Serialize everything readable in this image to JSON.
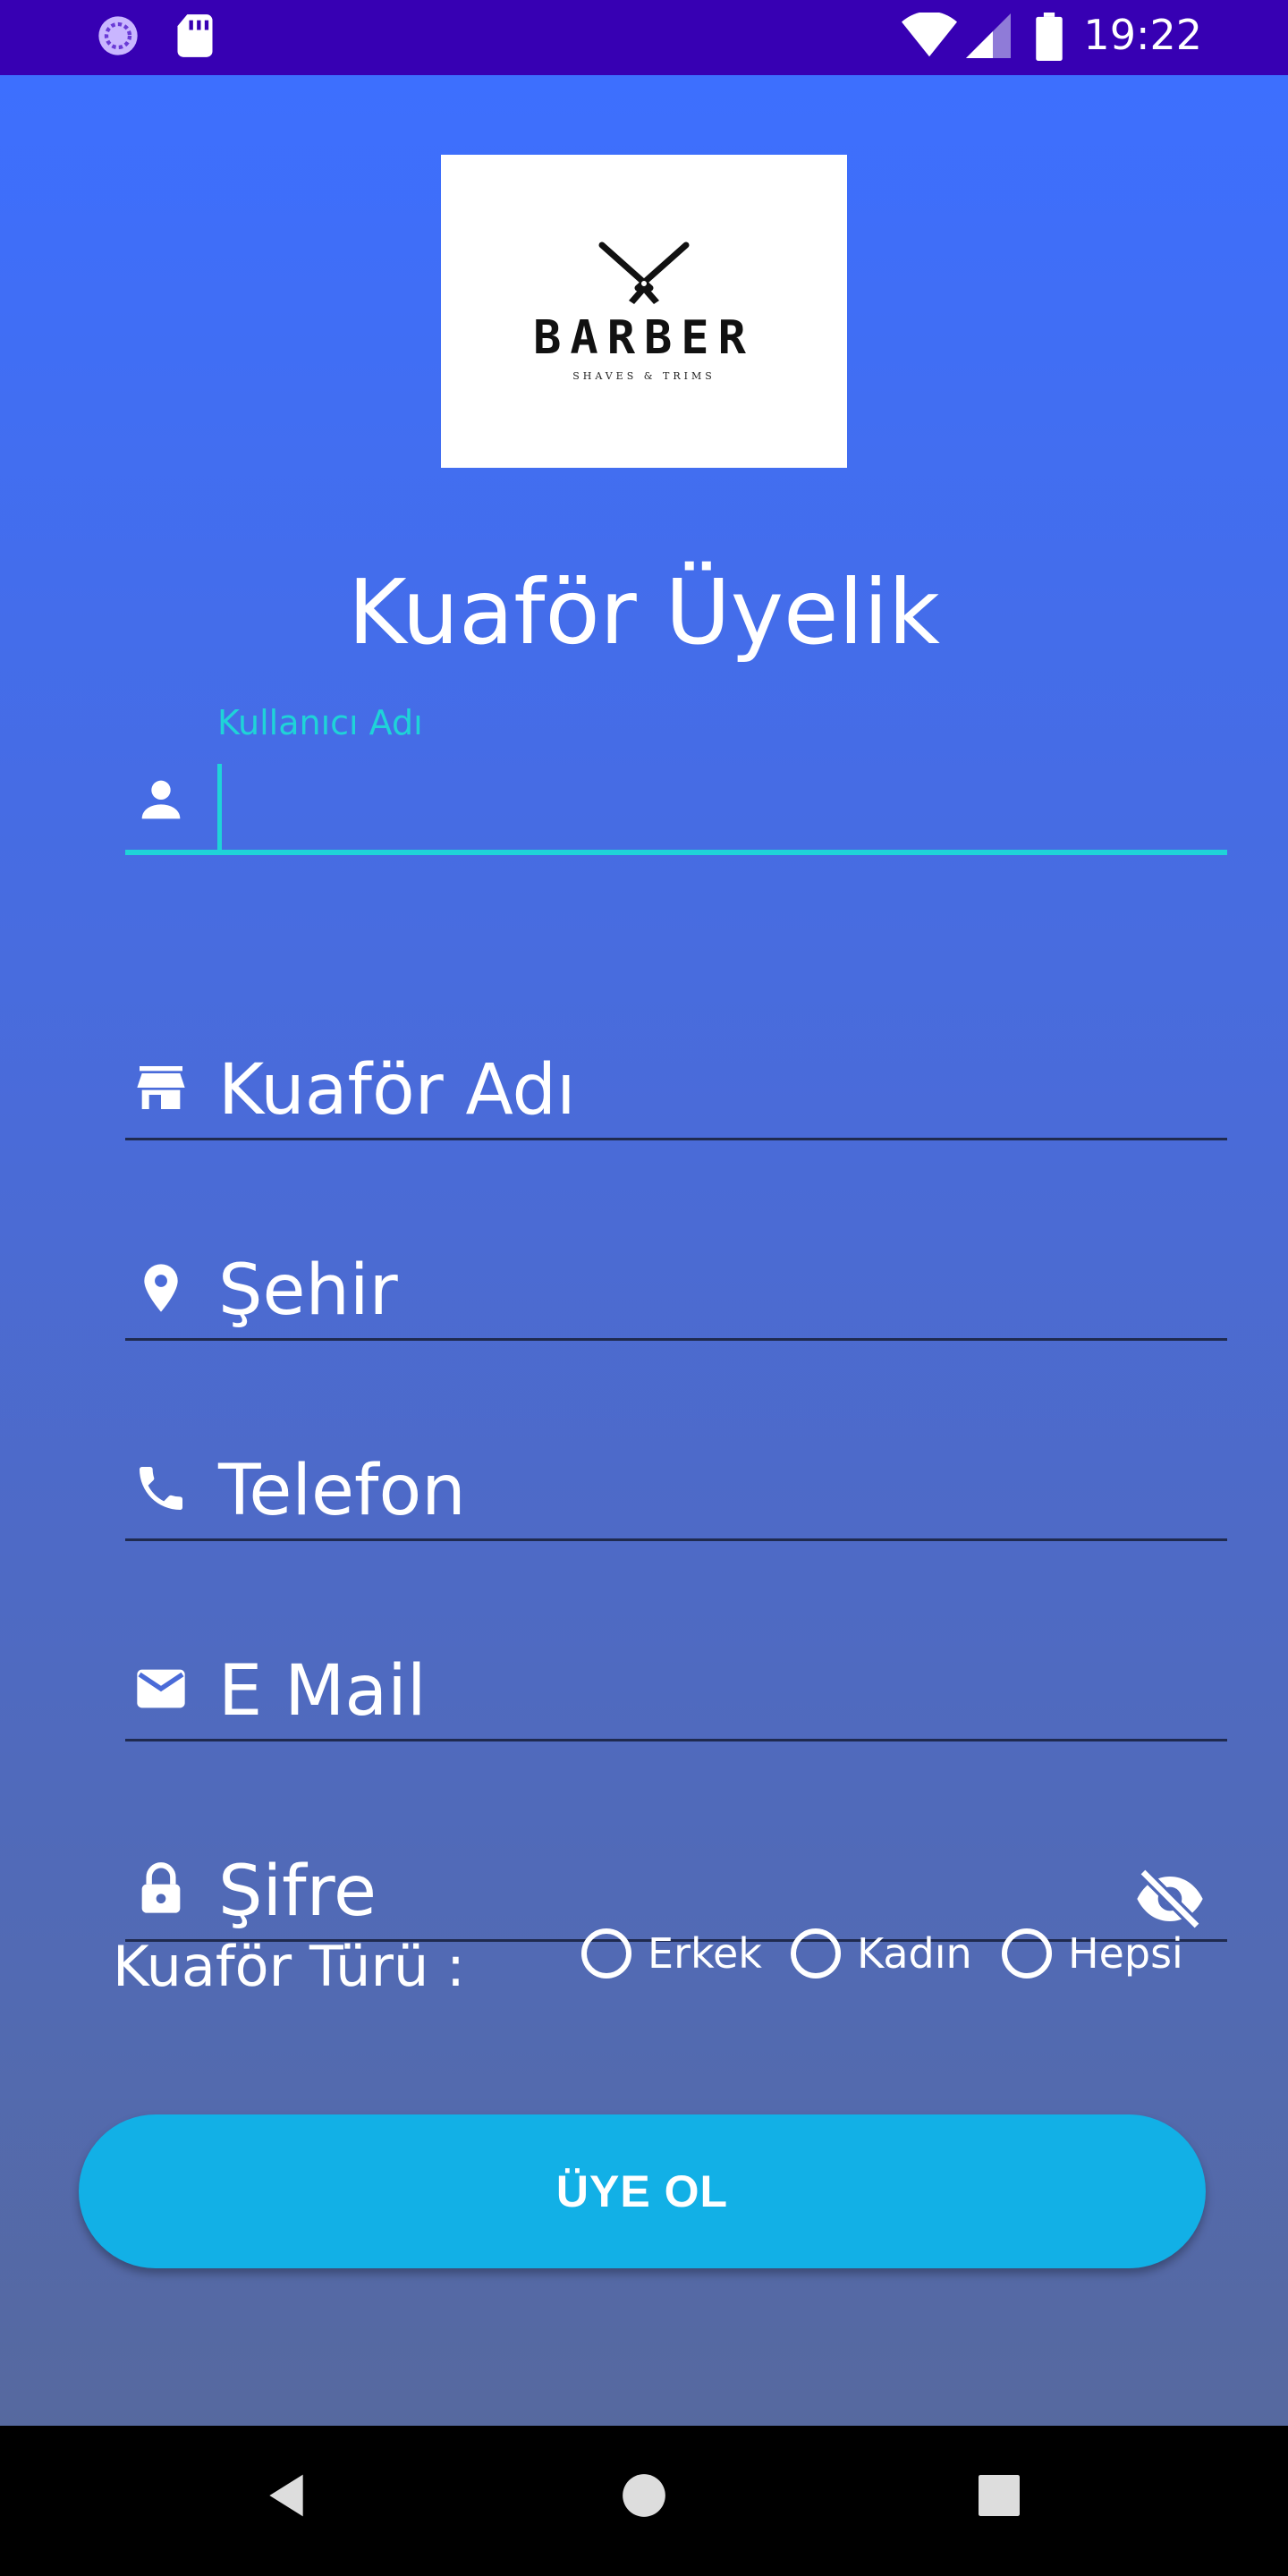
{
  "status_bar": {
    "time": "19:22",
    "icons": [
      "sync-icon",
      "sd-card-icon",
      "wifi-icon",
      "signal-icon",
      "battery-icon"
    ]
  },
  "logo": {
    "wordmark": "BARBER",
    "tagline": "SHAVES & TRIMS",
    "icon": "crossed-razors-icon"
  },
  "page": {
    "title": "Kuaför Üyelik"
  },
  "form": {
    "username": {
      "label": "Kullanıcı Adı",
      "value": "",
      "icon": "person-icon",
      "focused": true
    },
    "salon_name": {
      "placeholder": "Kuaför Adı",
      "icon": "store-icon"
    },
    "city": {
      "placeholder": "Şehir",
      "icon": "location-pin-icon"
    },
    "phone": {
      "placeholder": "Telefon",
      "icon": "phone-icon"
    },
    "email": {
      "placeholder": "E Mail",
      "icon": "email-icon"
    },
    "password": {
      "placeholder": "Şifre",
      "icon": "lock-icon",
      "toggle_icon": "eye-off-icon"
    }
  },
  "salon_type": {
    "label": "Kuaför Türü :",
    "options": [
      "Erkek",
      "Kadın",
      "Hepsi"
    ],
    "selected": null
  },
  "submit": {
    "label": "ÜYE OL"
  },
  "nav_bar": {
    "icons": [
      "back-icon",
      "home-icon",
      "recents-icon"
    ]
  },
  "colors": {
    "accent": "#1fd3d8",
    "button": "#12b0e6",
    "status_bar": "#3700b3",
    "gradient_top": "#3d6ffe",
    "gradient_bottom": "#56699f"
  }
}
